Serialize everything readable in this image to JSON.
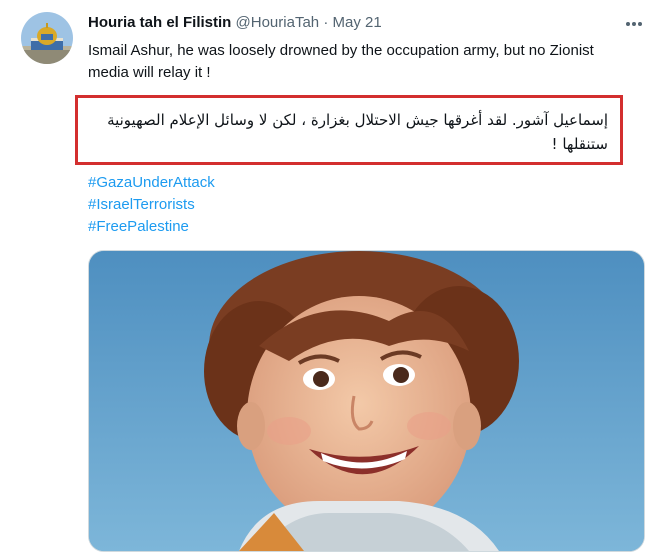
{
  "tweet": {
    "author_name": "Houria tah el Filistin",
    "handle": "@HouriaTah",
    "separator": "·",
    "date": "May 21",
    "text_en": "Ismail Ashur, he was loosely drowned by the occupation army, but no Zionist media will relay it !",
    "text_ar": "إسماعيل آشور. لقد أغرقها جيش الاحتلال بغزارة ، لكن لا وسائل الإعلام الصهيونية ستنقلها !",
    "hashtags": [
      "#GazaUnderAttack",
      "#IsraelTerrorists",
      "#FreePalestine"
    ]
  },
  "icons": {
    "avatar": "dome-of-the-rock-avatar",
    "more": "more-options-icon"
  },
  "colors": {
    "link": "#1d9bf0",
    "highlight_border": "#d32f2f",
    "muted": "#536471"
  }
}
